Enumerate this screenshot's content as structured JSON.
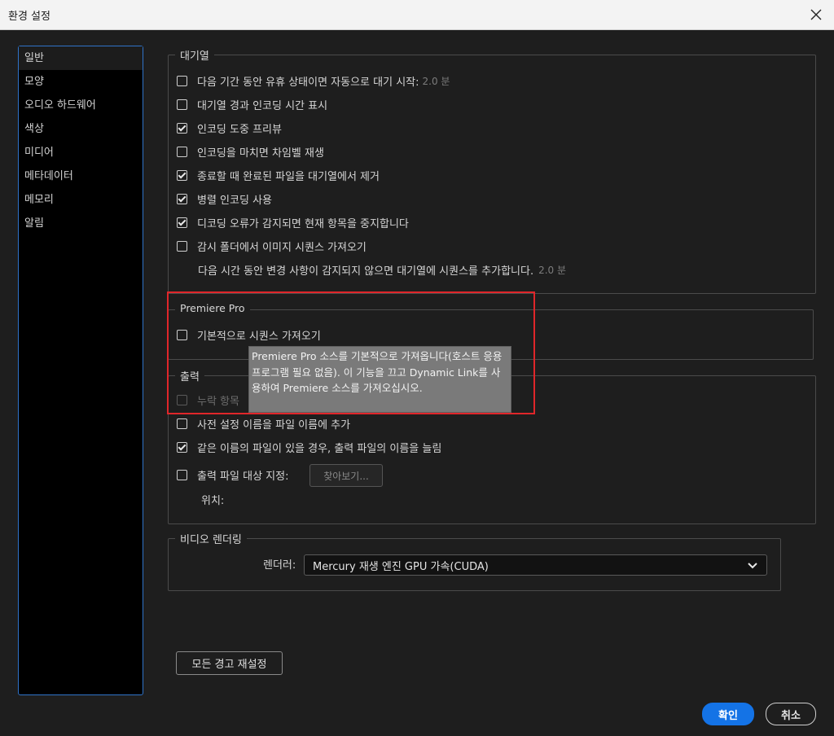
{
  "window": {
    "title": "환경 설정"
  },
  "sidebar": {
    "items": [
      {
        "label": "일반"
      },
      {
        "label": "모양"
      },
      {
        "label": "오디오 하드웨어"
      },
      {
        "label": "색상"
      },
      {
        "label": "미디어"
      },
      {
        "label": "메타데이터"
      },
      {
        "label": "메모리"
      },
      {
        "label": "알림"
      }
    ]
  },
  "queue": {
    "title": "대기열",
    "auto_start_label": "다음 기간 동안 유휴 상태이면 자동으로 대기 시작:",
    "auto_start_value": "2.0 분",
    "show_encode_time_label": "대기열 경과 인코딩 시간 표시",
    "preview_label": "인코딩 도중 프리뷰",
    "chime_label": "인코딩을 마치면 차임벨 재생",
    "remove_done_label": "종료할 때 완료된 파일을 대기열에서 제거",
    "parallel_label": "병렬 인코딩 사용",
    "stop_on_error_label": "디코딩 오류가 감지되면 현재 항목을 중지합니다",
    "watch_folder_label": "감시 폴더에서 이미지 시퀀스 가져오기",
    "watch_folder_sub_label": "다음 시간 동안 변경 사항이 감지되지 않으면 대기열에 시퀀스를 추가합니다.",
    "watch_folder_sub_value": "2.0 분"
  },
  "premiere": {
    "title": "Premiere Pro",
    "import_sequences_label": "기본적으로 시퀀스 가져오기",
    "tooltip": "Premiere Pro 소스를 기본적으로 가져옵니다(호스트 응용 프로그램 필요 없음). 이 기능을 끄고 Dynamic Link를 사용하여 Premiere 소스를 가져오십시오."
  },
  "output": {
    "title": "출력",
    "missing_label": "누락 항목",
    "append_preset_label": "사전 설정 이름을 파일 이름에 추가",
    "increment_label": "같은 이름의 파일이 있을 경우, 출력 파일의 이름을 늘림",
    "destination_label": "출력 파일 대상 지정:",
    "browse_label": "찾아보기...",
    "location_label": "위치:"
  },
  "video_rendering": {
    "title": "비디오 렌더링",
    "renderer_label": "렌더러:",
    "renderer_value": "Mercury 재생 엔진 GPU 가속(CUDA)"
  },
  "buttons": {
    "reset_warnings": "모든 경고 재설정",
    "ok": "확인",
    "cancel": "취소"
  },
  "checkbox_states": {
    "auto_start": false,
    "show_encode_time": false,
    "preview": true,
    "chime": false,
    "remove_done": true,
    "parallel": true,
    "stop_on_error": true,
    "watch_folder": false,
    "import_sequences": false,
    "missing": false,
    "append_preset": false,
    "increment": true,
    "destination": false
  },
  "colors": {
    "accent": "#1473e6",
    "highlight_box": "#e0262a",
    "sidebar_border": "#2f73c9"
  }
}
